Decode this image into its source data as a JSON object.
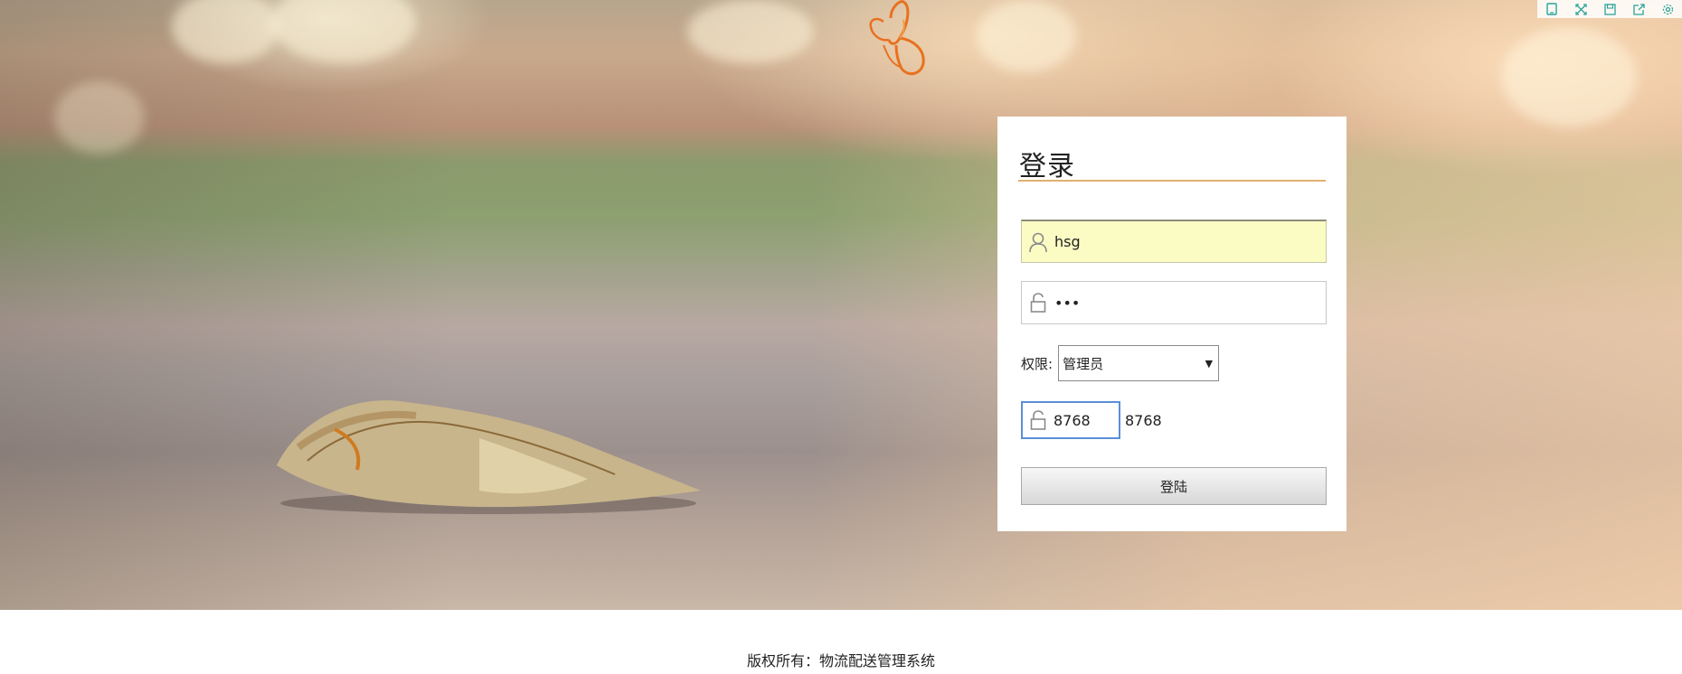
{
  "toolbar": {
    "icons": [
      "tablet-icon",
      "expand-icon",
      "save-icon",
      "share-icon",
      "settings-icon"
    ]
  },
  "login": {
    "title": "登录",
    "username": {
      "value": "hsg"
    },
    "password": {
      "value": "•••"
    },
    "role": {
      "label": "权限:",
      "selected": "管理员"
    },
    "captcha": {
      "value": "8768",
      "code": "8768"
    },
    "submit_label": "登陆"
  },
  "footer": {
    "text": "版权所有：物流配送管理系统"
  },
  "colors": {
    "title_rule": "#e0b070",
    "username_bg": "#fafcc3",
    "captcha_focus": "#5b8fd6",
    "butterfly": "#e8711f",
    "toolbar_icon": "#2aa39a"
  }
}
